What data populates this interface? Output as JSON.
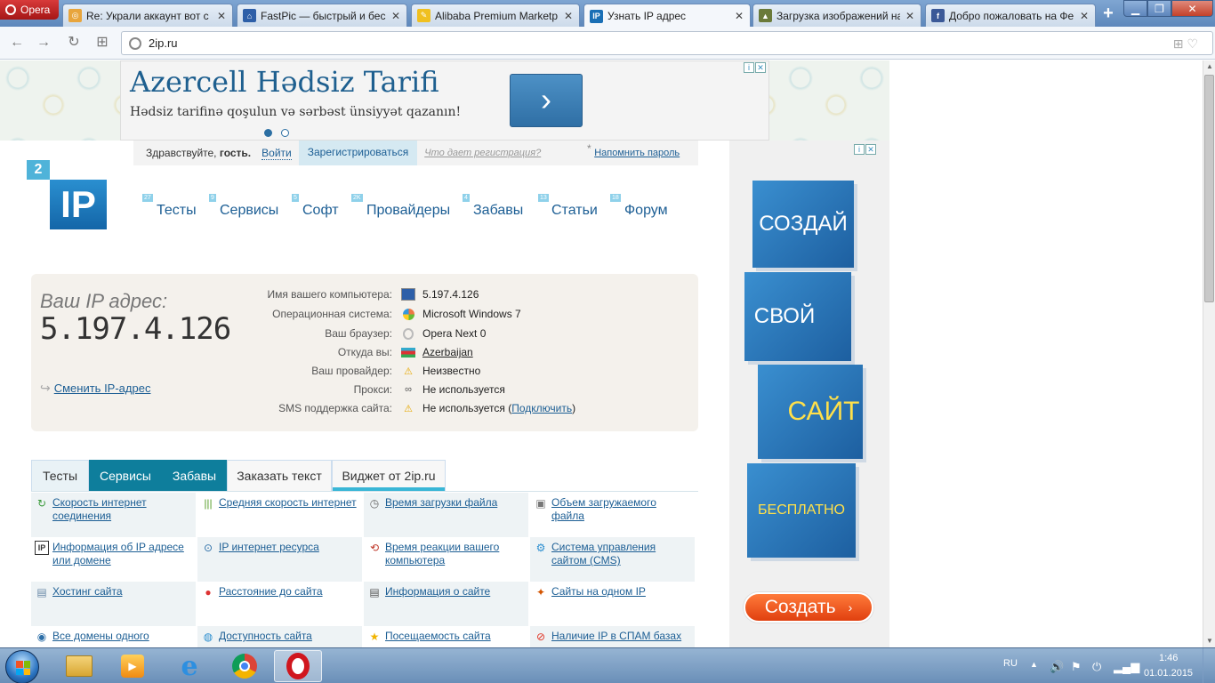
{
  "browser": {
    "menu_label": "Opera",
    "tabs": [
      {
        "title": "Re: Украли аккаунт вот с",
        "fav_color": "#e8a53c",
        "fav_glyph": "◎"
      },
      {
        "title": "FastPic — быстрый и бес",
        "fav_color": "#2e5fa8",
        "fav_glyph": "⌂"
      },
      {
        "title": "Alibaba Premium Marketp",
        "fav_color": "#f0c020",
        "fav_glyph": "✎"
      },
      {
        "title": "Узнать IP адрес",
        "fav_color": "#1a6fb5",
        "fav_glyph": "IP"
      },
      {
        "title": "Загрузка изображений на",
        "fav_color": "#6a7a3a",
        "fav_glyph": "▲"
      },
      {
        "title": "Добро пожаловать на Фе",
        "fav_color": "#3b5998",
        "fav_glyph": "f"
      }
    ],
    "url": "2ip.ru"
  },
  "top_ad": {
    "title": "Azercell Hədsiz Tarifi",
    "subtitle": "Hədsiz tarifinə qoşulun və sərbəst ünsiyyət qazanın!",
    "arrow": "›"
  },
  "userbar": {
    "greet_prefix": "Здравствуйте, ",
    "greet_user": "гость.",
    "login": "Войти",
    "register": "Зарегистрироваться",
    "reg_info": "Что дает регистрация?",
    "asterisk": "*",
    "remind": "Напомнить пароль"
  },
  "logo": {
    "part1": "2",
    "part2": "IP"
  },
  "nav": [
    {
      "label": "Тесты",
      "count": "27"
    },
    {
      "label": "Сервисы",
      "count": "9"
    },
    {
      "label": "Софт",
      "count": "5"
    },
    {
      "label": "Провайдеры",
      "count": "2K"
    },
    {
      "label": "Забавы",
      "count": "4"
    },
    {
      "label": "Статьи",
      "count": "13"
    },
    {
      "label": "Форум",
      "count": "18"
    }
  ],
  "ipbox": {
    "caption": "Ваш IP адрес:",
    "ip": "5.197.4.126",
    "change_ip": "Сменить IP-адрес",
    "rows": [
      {
        "label": "Имя вашего компьютера:",
        "value": "5.197.4.126",
        "icon": "computer-icon"
      },
      {
        "label": "Операционная система:",
        "value": "Microsoft Windows 7",
        "icon": "windows-icon"
      },
      {
        "label": "Ваш браузер:",
        "value": "Opera Next 0",
        "icon": "browser-icon"
      },
      {
        "label": "Откуда вы:",
        "value": "Azerbaijan",
        "icon": "flag-icon"
      },
      {
        "label": "Ваш провайдер:",
        "value": "Неизвестно",
        "icon": "warning-icon"
      },
      {
        "label": "Прокси:",
        "value": "Не используется",
        "icon": "glasses-icon"
      },
      {
        "label": "SMS поддержка сайта:",
        "value": "Не используется",
        "icon": "warning-icon",
        "paren_open": " (",
        "link": "Подключить",
        "paren_close": ")"
      }
    ]
  },
  "page_tabs": [
    "Тесты",
    "Сервисы",
    "Забавы",
    "Заказать текст",
    "Виджет от 2ip.ru"
  ],
  "services": [
    {
      "text": "Скорость интернет соединения",
      "icon": "speed-arrow-icon"
    },
    {
      "text": "Средняя скорость интернет",
      "icon": "bars-icon"
    },
    {
      "text": "Время загрузки файла",
      "icon": "clock-icon"
    },
    {
      "text": "Объем загружаемого файла",
      "icon": "file-size-icon"
    },
    {
      "text": "Информация об IP адресе или домене",
      "icon": "ip-info-icon"
    },
    {
      "text": "IP интернет ресурса",
      "icon": "ip-resource-icon"
    },
    {
      "text": "Время реакции вашего компьютера",
      "icon": "reaction-icon"
    },
    {
      "text": "Система управления сайтом (CMS)",
      "icon": "cms-icon"
    },
    {
      "text": "Хостинг сайта",
      "icon": "hosting-icon"
    },
    {
      "text": "Расстояние до сайта",
      "icon": "pin-icon"
    },
    {
      "text": "Информация о сайте",
      "icon": "site-info-icon"
    },
    {
      "text": "Сайты на одном IP",
      "icon": "same-ip-icon"
    },
    {
      "text": "Все домены одного",
      "icon": "domains-icon"
    },
    {
      "text": "Доступность сайта",
      "icon": "availability-icon"
    },
    {
      "text": "Посещаемость сайта",
      "icon": "star-icon"
    },
    {
      "text": "Наличие IP в СПАМ базах",
      "icon": "spam-icon"
    }
  ],
  "side_ad": {
    "words": [
      "СОЗДАЙ",
      "СВОЙ",
      "САЙТ",
      "БЕСПЛАТНО"
    ],
    "button": "Создать",
    "button_arrow": "›"
  },
  "taskbar": {
    "lang": "RU",
    "time": "1:46",
    "date": "01.01.2015"
  }
}
